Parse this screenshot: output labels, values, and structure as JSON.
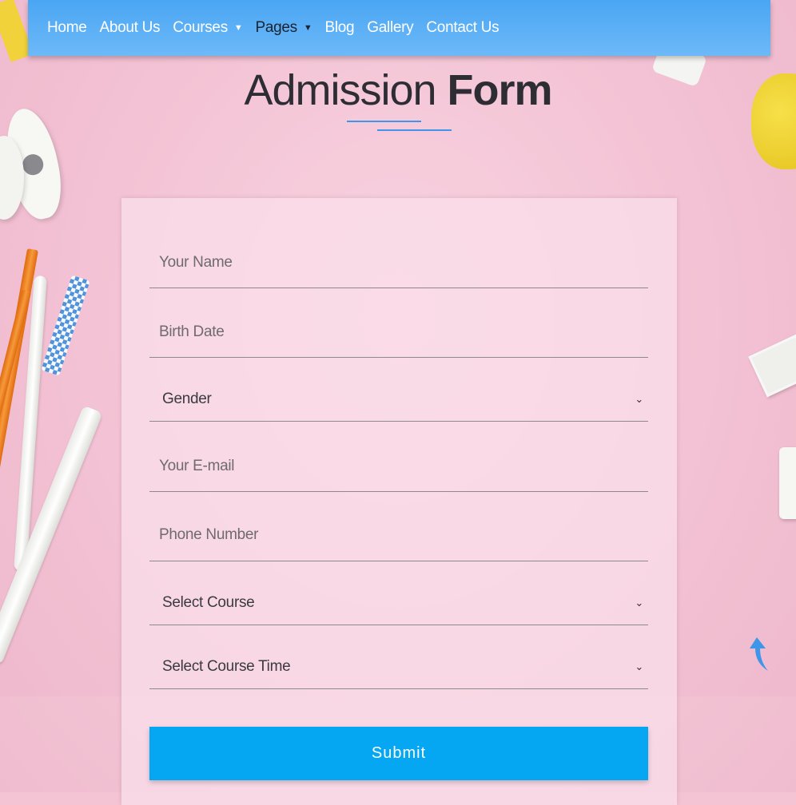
{
  "nav": {
    "items": [
      {
        "label": "Home"
      },
      {
        "label": "About Us"
      },
      {
        "label": "Courses"
      },
      {
        "label": "Pages"
      },
      {
        "label": "Blog"
      },
      {
        "label": "Gallery"
      },
      {
        "label": "Contact Us"
      }
    ]
  },
  "page_title": {
    "light": "Admission",
    "bold": "Form"
  },
  "form": {
    "name_placeholder": "Your Name",
    "birth_placeholder": "Birth Date",
    "gender_selected": "Gender",
    "email_placeholder": "Your E-mail",
    "phone_placeholder": "Phone Number",
    "course_selected": "Select Course",
    "course_time_selected": "Select Course Time",
    "submit_label": "Submit"
  },
  "colors": {
    "accent": "#05a7f2",
    "navbar": "#4aa6f3",
    "background": "#f4c4d5"
  },
  "icons": {
    "dropdown": "chevron-down-icon",
    "nav_dropdown": "caret-down-icon",
    "scroll_top": "arrow-up-icon"
  }
}
